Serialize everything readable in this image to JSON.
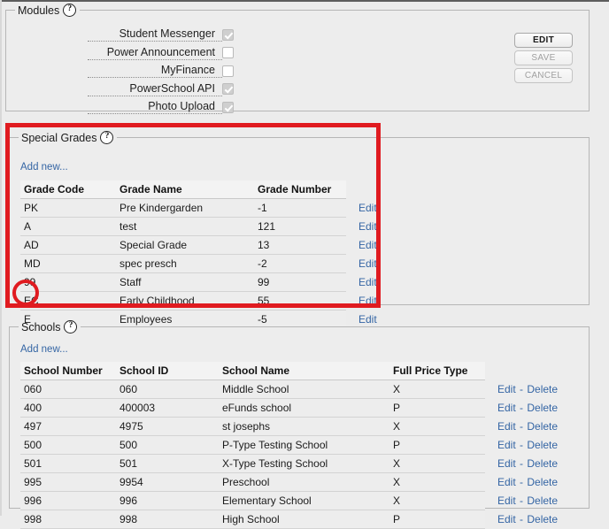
{
  "modules": {
    "legend": "Modules",
    "help_icon": "help-question-icon",
    "items": [
      {
        "label": "Student Messenger",
        "checked": true
      },
      {
        "label": "Power Announcement",
        "checked": false
      },
      {
        "label": "MyFinance",
        "checked": false
      },
      {
        "label": "PowerSchool API",
        "checked": true
      },
      {
        "label": "Photo Upload",
        "checked": true
      }
    ],
    "buttons": [
      {
        "label": "EDIT",
        "enabled": true
      },
      {
        "label": "SAVE",
        "enabled": false
      },
      {
        "label": "CANCEL",
        "enabled": false
      }
    ]
  },
  "special_grades": {
    "legend": "Special Grades",
    "help_icon": "help-question-icon",
    "add_new": "Add new...",
    "columns": [
      "Grade Code",
      "Grade Name",
      "Grade Number"
    ],
    "action_label": "Edit",
    "rows": [
      {
        "code": "PK",
        "name": "Pre Kindergarden",
        "number": "-1"
      },
      {
        "code": "A",
        "name": "test",
        "number": "121"
      },
      {
        "code": "AD",
        "name": "Special Grade",
        "number": "13"
      },
      {
        "code": "MD",
        "name": "spec presch",
        "number": "-2"
      },
      {
        "code": "99",
        "name": "Staff",
        "number": "99"
      },
      {
        "code": "EC",
        "name": "Early Childhood",
        "number": "55"
      },
      {
        "code": "E",
        "name": "Employees",
        "number": "-5"
      }
    ]
  },
  "schools": {
    "legend": "Schools",
    "help_icon": "help-question-icon",
    "add_new": "Add new...",
    "columns": [
      "School Number",
      "School ID",
      "School Name",
      "Full Price Type"
    ],
    "edit_label": "Edit",
    "delete_label": "Delete",
    "separator": "-",
    "rows": [
      {
        "number": "060",
        "id": "060",
        "name": "Middle School",
        "price_type": "X"
      },
      {
        "number": "400",
        "id": "400003",
        "name": "eFunds school",
        "price_type": "P"
      },
      {
        "number": "497",
        "id": "4975",
        "name": "st josephs",
        "price_type": "X"
      },
      {
        "number": "500",
        "id": "500",
        "name": "P-Type Testing School",
        "price_type": "P"
      },
      {
        "number": "501",
        "id": "501",
        "name": "X-Type Testing School",
        "price_type": "X"
      },
      {
        "number": "995",
        "id": "9954",
        "name": "Preschool",
        "price_type": "X"
      },
      {
        "number": "996",
        "id": "996",
        "name": "Elementary School",
        "price_type": "X"
      },
      {
        "number": "998",
        "id": "998",
        "name": "High School",
        "price_type": "P"
      }
    ]
  },
  "annotations": {
    "color": "#e01b20",
    "rect_target": "special-grades-panel",
    "circle_target": "grade-code-E"
  },
  "help_glyph": "?"
}
